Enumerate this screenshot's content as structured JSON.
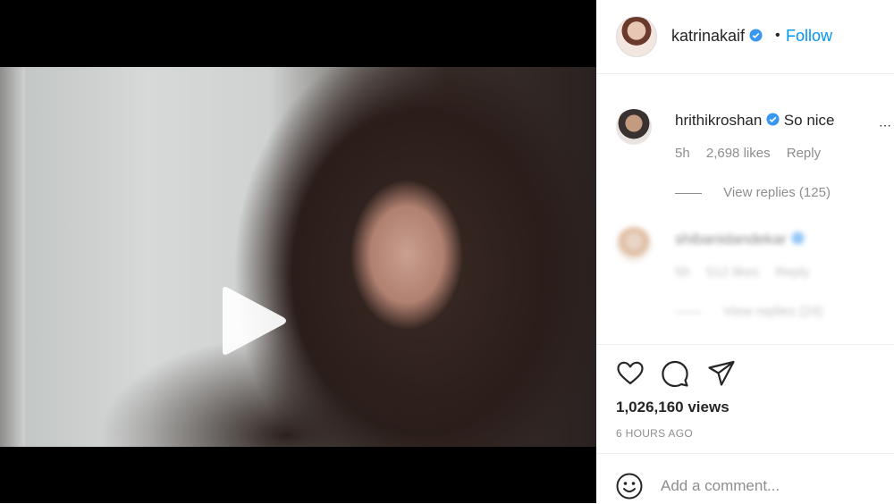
{
  "post": {
    "username": "katrinakaif",
    "separator": "•",
    "follow_label": "Follow",
    "views": "1,026,160 views",
    "time_ago": "6 HOURS AGO"
  },
  "comments": [
    {
      "username": "hrithikroshan",
      "text": "So nice",
      "time": "5h",
      "likes": "2,698 likes",
      "reply_label": "Reply",
      "view_replies": "View replies (125)"
    },
    {
      "username": "shibanidandekar",
      "text": "",
      "time": "5h",
      "likes": "512 likes",
      "reply_label": "Reply",
      "view_replies": "View replies (24)"
    }
  ],
  "add_comment": {
    "placeholder": "Add a comment..."
  },
  "icons": {
    "like": "heart-icon",
    "comment": "comment-bubble-icon",
    "share": "paper-plane-icon",
    "play": "play-icon",
    "mute": "muted-speaker-icon",
    "emoji": "smile-icon",
    "verified": "verified-badge-icon"
  },
  "colors": {
    "accent": "#0095f6",
    "verified": "#3897f0",
    "muted_text": "#8e8e8e"
  }
}
